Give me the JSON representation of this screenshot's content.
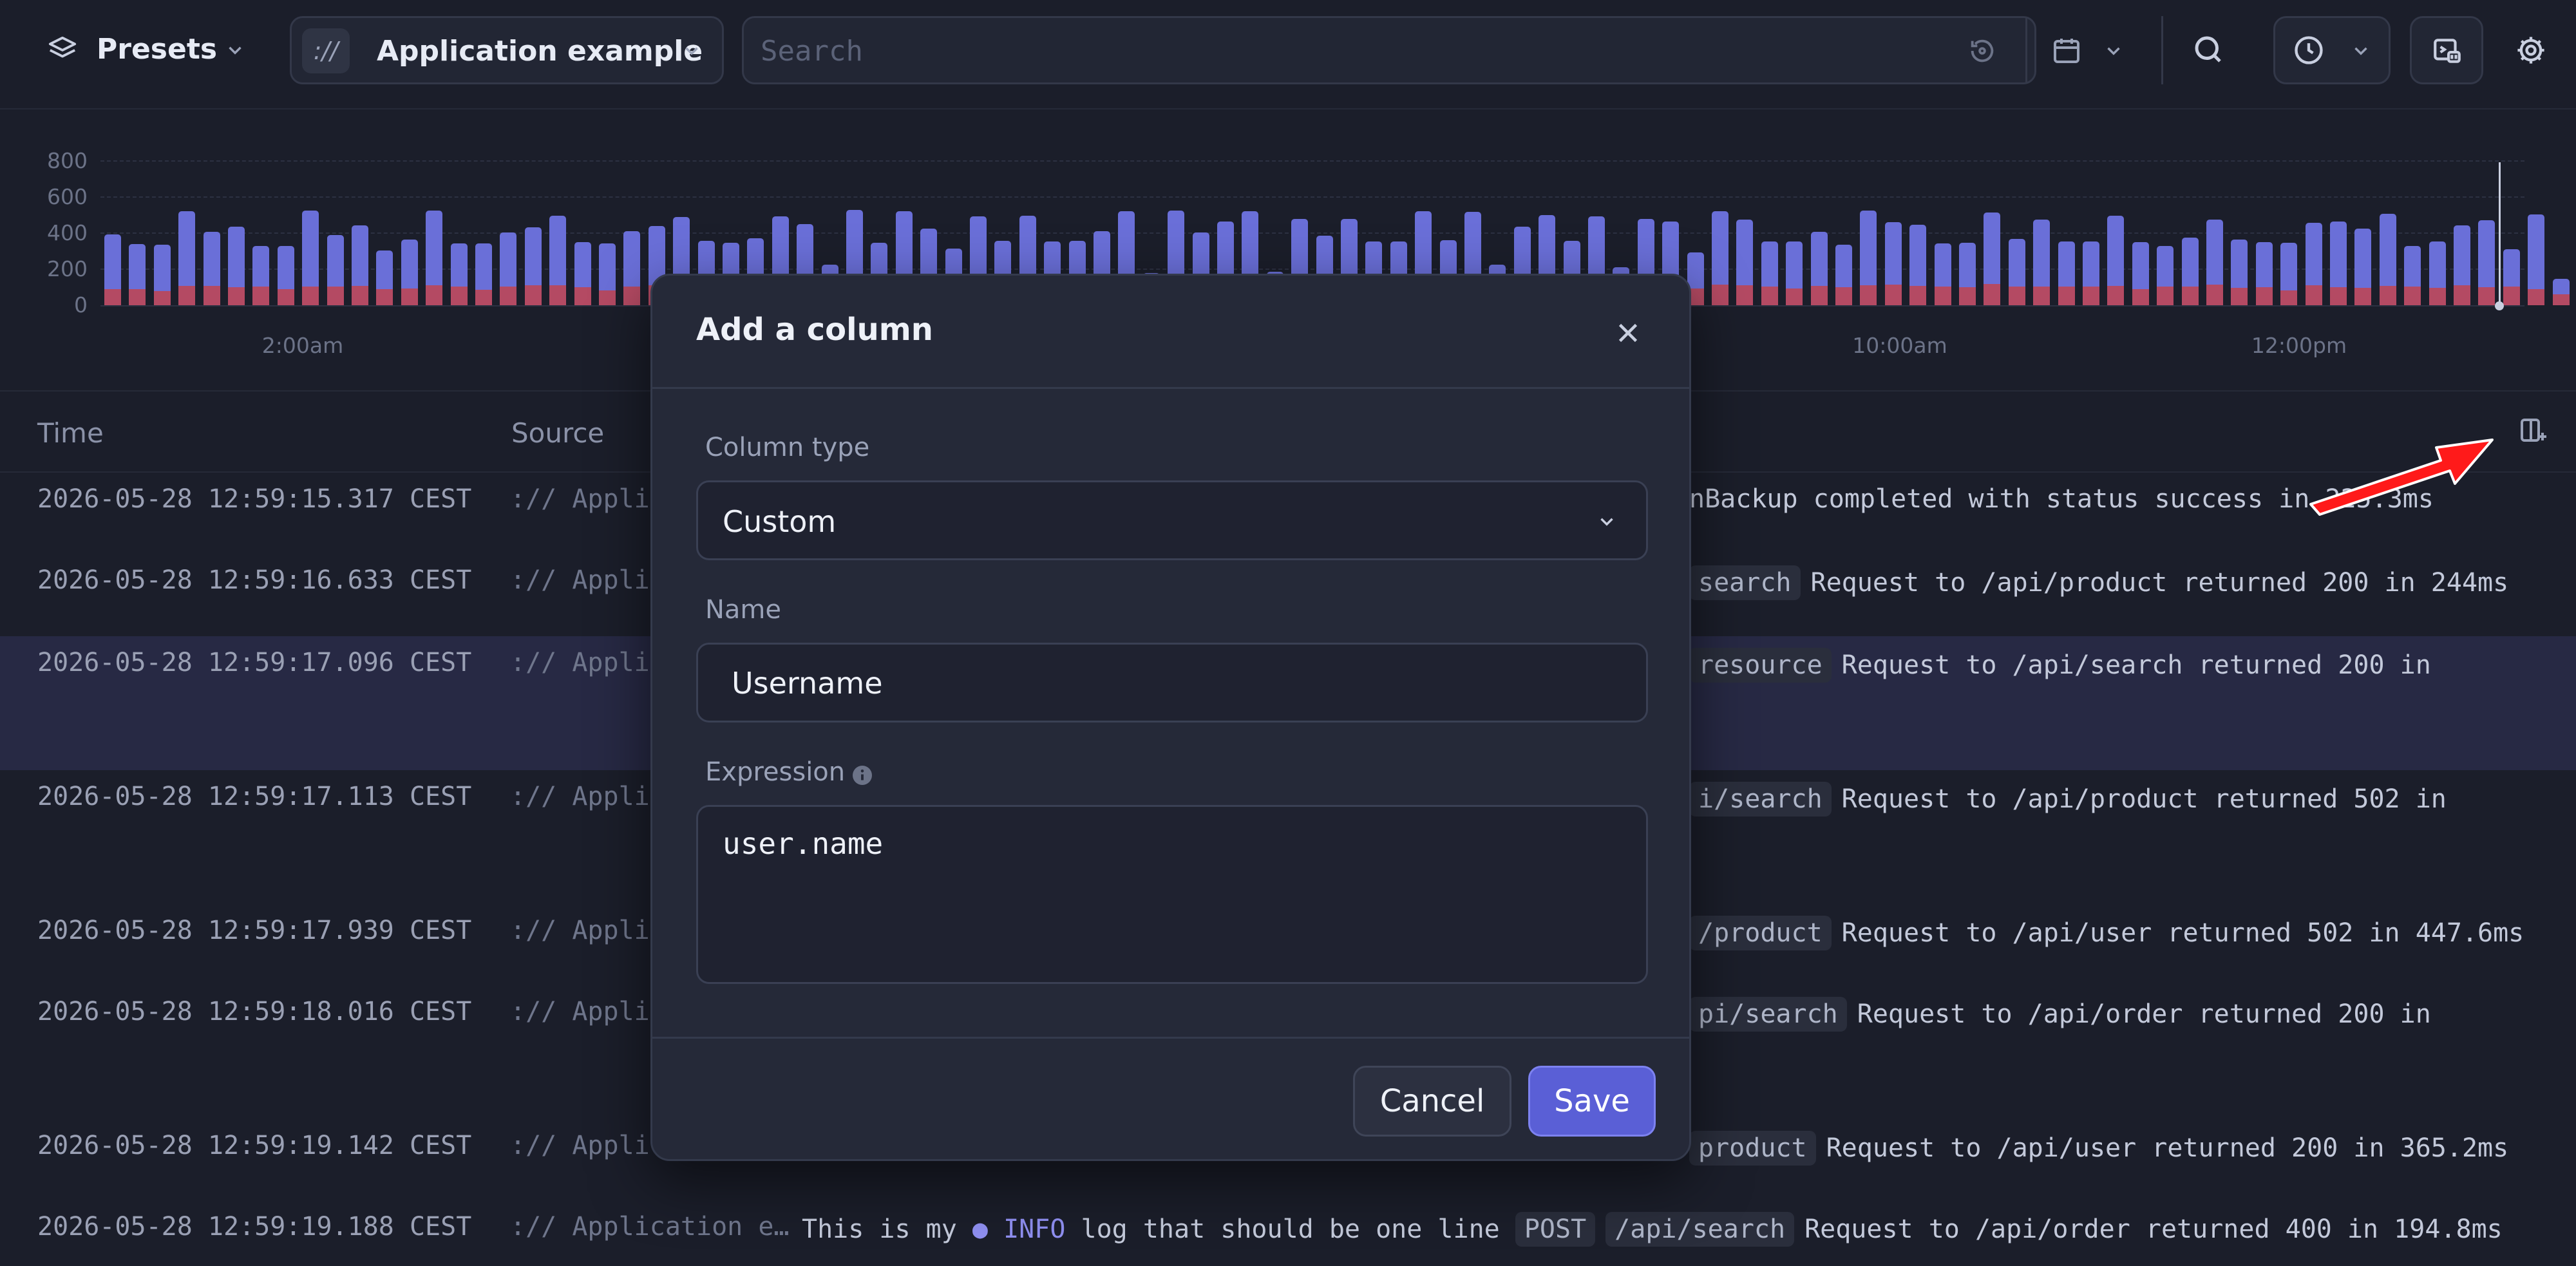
{
  "topbar": {
    "presets_label": "Presets",
    "source_badge": "://",
    "source_label": "Application example",
    "search_placeholder": "Search"
  },
  "histogram": {
    "y_ticks": [
      "800",
      "600",
      "400",
      "200",
      "0"
    ],
    "x_ticks": [
      {
        "label": "2:00am",
        "x": 470
      },
      {
        "label": "10:00am",
        "x": 2950
      },
      {
        "label": "12:00pm",
        "x": 3570
      }
    ],
    "bars": [
      [
        1.96,
        0.44
      ],
      [
        1.69,
        0.45
      ],
      [
        1.68,
        0.39
      ],
      [
        2.6,
        0.53
      ],
      [
        2.03,
        0.53
      ],
      [
        2.17,
        0.5
      ],
      [
        1.65,
        0.51
      ],
      [
        1.65,
        0.44
      ],
      [
        2.62,
        0.52
      ],
      [
        1.94,
        0.51
      ],
      [
        2.21,
        0.54
      ],
      [
        1.52,
        0.44
      ],
      [
        1.83,
        0.47
      ],
      [
        2.62,
        0.56
      ],
      [
        1.71,
        0.52
      ],
      [
        1.71,
        0.42
      ],
      [
        2.02,
        0.51
      ],
      [
        2.16,
        0.55
      ],
      [
        2.48,
        0.56
      ],
      [
        1.75,
        0.5
      ],
      [
        1.72,
        0.41
      ],
      [
        2.05,
        0.51
      ],
      [
        2.2,
        0.56
      ],
      [
        2.45,
        0.51
      ],
      [
        1.79,
        0.5
      ],
      [
        1.74,
        0.43
      ],
      [
        1.85,
        0.42
      ],
      [
        2.46,
        0.51
      ],
      [
        2.25,
        0.53
      ],
      [
        1.13,
        0.5
      ],
      [
        2.64,
        0.5
      ],
      [
        1.73,
        0.48
      ],
      [
        2.61,
        0.54
      ],
      [
        2.13,
        0.46
      ],
      [
        1.58,
        0.43
      ],
      [
        2.47,
        0.5
      ],
      [
        1.79,
        0.52
      ],
      [
        2.49,
        0.51
      ],
      [
        1.77,
        0.45
      ],
      [
        1.78,
        0.49
      ],
      [
        2.06,
        0.53
      ],
      [
        2.61,
        0.51
      ],
      [
        0.9,
        0.47
      ],
      [
        2.62,
        0.5
      ],
      [
        2.01,
        0.48
      ],
      [
        2.33,
        0.54
      ],
      [
        2.61,
        0.49
      ],
      [
        0.93,
        0.45
      ],
      [
        2.4,
        0.49
      ],
      [
        1.92,
        0.52
      ],
      [
        2.39,
        0.53
      ],
      [
        1.76,
        0.47
      ],
      [
        1.76,
        0.47
      ],
      [
        2.6,
        0.52
      ],
      [
        1.8,
        0.46
      ],
      [
        2.59,
        0.53
      ],
      [
        1.12,
        0.47
      ],
      [
        2.17,
        0.51
      ],
      [
        2.5,
        0.49
      ],
      [
        1.78,
        0.47
      ],
      [
        2.47,
        0.56
      ],
      [
        1.05,
        0.52
      ],
      [
        2.4,
        0.5
      ],
      [
        2.32,
        0.53
      ],
      [
        1.47,
        0.47
      ],
      [
        2.61,
        0.57
      ],
      [
        2.38,
        0.55
      ],
      [
        1.76,
        0.51
      ],
      [
        1.77,
        0.47
      ],
      [
        2.03,
        0.53
      ],
      [
        1.67,
        0.5
      ],
      [
        2.62,
        0.56
      ],
      [
        2.31,
        0.57
      ],
      [
        2.23,
        0.54
      ],
      [
        1.72,
        0.51
      ],
      [
        1.73,
        0.5
      ],
      [
        2.57,
        0.59
      ],
      [
        1.84,
        0.52
      ],
      [
        2.38,
        0.51
      ],
      [
        1.76,
        0.51
      ],
      [
        1.76,
        0.52
      ],
      [
        2.48,
        0.53
      ],
      [
        1.75,
        0.45
      ],
      [
        1.64,
        0.51
      ],
      [
        1.88,
        0.51
      ],
      [
        2.38,
        0.57
      ],
      [
        1.82,
        0.48
      ],
      [
        1.75,
        0.5
      ],
      [
        1.74,
        0.41
      ],
      [
        2.29,
        0.56
      ],
      [
        2.33,
        0.5
      ],
      [
        2.12,
        0.49
      ],
      [
        2.54,
        0.54
      ],
      [
        1.64,
        0.51
      ],
      [
        1.76,
        0.48
      ],
      [
        2.21,
        0.55
      ],
      [
        2.35,
        0.5
      ],
      [
        1.56,
        0.52
      ],
      [
        2.52,
        0.44
      ],
      [
        0.73,
        0.3
      ]
    ]
  },
  "table": {
    "headers": {
      "time": "Time",
      "source": "Source"
    },
    "rows": [
      {
        "time": "2026-05-28 12:59:15.317 CEST",
        "source": ":// Applica",
        "msg_prefix": "",
        "chips": [],
        "msg": "nBackup completed with status success in 225.3ms",
        "msg_x": 2623
      },
      {
        "time": "2026-05-28 12:59:16.633 CEST",
        "source": ":// Applica",
        "msg_prefix": "",
        "chips": [
          "search"
        ],
        "msg": "Request to /api/product returned 200 in 244ms",
        "msg_x": 2623
      },
      {
        "time": "2026-05-28 12:59:17.096 CEST",
        "source": ":// Applica",
        "msg_prefix": "",
        "chips": [
          "resource"
        ],
        "msg": "Request to /api/search returned 200 in",
        "msg_x": 2623
      },
      {
        "time": "2026-05-28 12:59:17.113 CEST",
        "source": ":// Applica",
        "msg_prefix": "",
        "chips": [
          "i/search"
        ],
        "msg": "Request to /api/product returned 502 in",
        "msg_x": 2623
      },
      {
        "time": "2026-05-28 12:59:17.939 CEST",
        "source": ":// Applica",
        "msg_prefix": "",
        "chips": [
          "/product"
        ],
        "msg": "Request to /api/user returned 502 in 447.6ms",
        "msg_x": 2623
      },
      {
        "time": "2026-05-28 12:59:18.016 CEST",
        "source": ":// Applica",
        "msg_prefix": "",
        "chips": [
          "pi/search"
        ],
        "msg": "Request to /api/order returned 200 in",
        "msg_x": 2623
      },
      {
        "time": "2026-05-28 12:59:19.142 CEST",
        "source": ":// Applica",
        "msg_prefix": "",
        "chips": [
          "product"
        ],
        "msg": "Request to /api/user returned 200 in 365.2ms",
        "msg_x": 2623
      },
      {
        "time": "2026-05-28 12:59:19.188 CEST",
        "source": ":// Application e…",
        "msg_prefix": "This is my",
        "level": "● INFO",
        "msg_mid": "log that should be one line",
        "chips": [
          "POST",
          "/api/search"
        ],
        "msg": "Request to /api/order returned 400 in 194.8ms",
        "msg_x": 1245
      }
    ]
  },
  "modal": {
    "title": "Add a column",
    "column_type_label": "Column type",
    "column_type_value": "Custom",
    "name_label": "Name",
    "name_value": "Username",
    "expression_label": "Expression",
    "expression_value": "user.name",
    "cancel_label": "Cancel",
    "save_label": "Save"
  },
  "colors": {
    "info_bar": "#6a6fd8",
    "error_bar": "#b44a63",
    "accent": "#5a5fd6",
    "annotation_arrow": "#ff1a1a"
  }
}
